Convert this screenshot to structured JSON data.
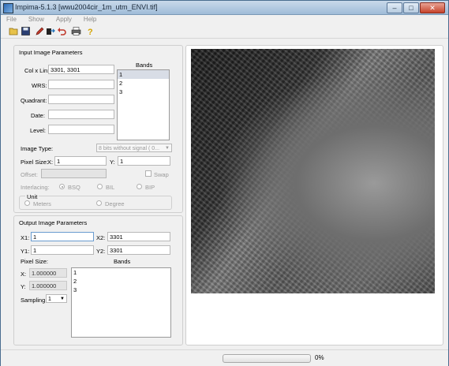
{
  "window": {
    "title": "Impima-5.1.3 [wwu2004cir_1m_utm_ENVI.tif]"
  },
  "menu": [
    "File",
    "Show",
    "Apply",
    "Help"
  ],
  "toolbar_icons": [
    "open-folder-icon",
    "save-icon",
    "pencil-icon",
    "export-icon",
    "undo-icon",
    "print-icon",
    "help-icon"
  ],
  "input": {
    "section_title": "Input Image Parameters",
    "col_lin_label": "Col x Lin:",
    "col_lin_value": "3301, 3301",
    "wrs_label": "WRS:",
    "quadrant_label": "Quadrant:",
    "date_label": "Date:",
    "level_label": "Level:",
    "bands_title": "Bands",
    "bands": [
      "1",
      "2",
      "3"
    ],
    "image_type_label": "Image Type:",
    "image_type_value": "8 bits without signal ( 0...",
    "pixel_size_label": "Pixel Size:",
    "x_label": "X:",
    "x_value": "1",
    "y_label": "Y:",
    "y_value": "1",
    "offset_label": "Offset:",
    "swap_label": "Swap",
    "interlacing_label": "Interlacing:",
    "interlacing_options": [
      "BSQ",
      "BIL",
      "BIP"
    ],
    "unit_title": "Unit",
    "unit_options": [
      "Meters",
      "Degree"
    ]
  },
  "output": {
    "section_title": "Output Image Parameters",
    "x1_label": "X1:",
    "x1_value": "1",
    "x2_label": "X2:",
    "x2_value": "3301",
    "y1_label": "Y1:",
    "y1_value": "1",
    "y2_label": "Y2:",
    "y2_value": "3301",
    "pixel_size_label": "Pixel Size:",
    "bands_title": "Bands",
    "px_label": "X:",
    "px_value": "1.000000",
    "py_label": "Y:",
    "py_value": "1.000000",
    "bands": [
      "1",
      "2",
      "3"
    ],
    "sampling_label": "Sampling",
    "sampling_value": "1"
  },
  "status": {
    "progress_fraction": 0.0,
    "progress_text": "0%"
  }
}
